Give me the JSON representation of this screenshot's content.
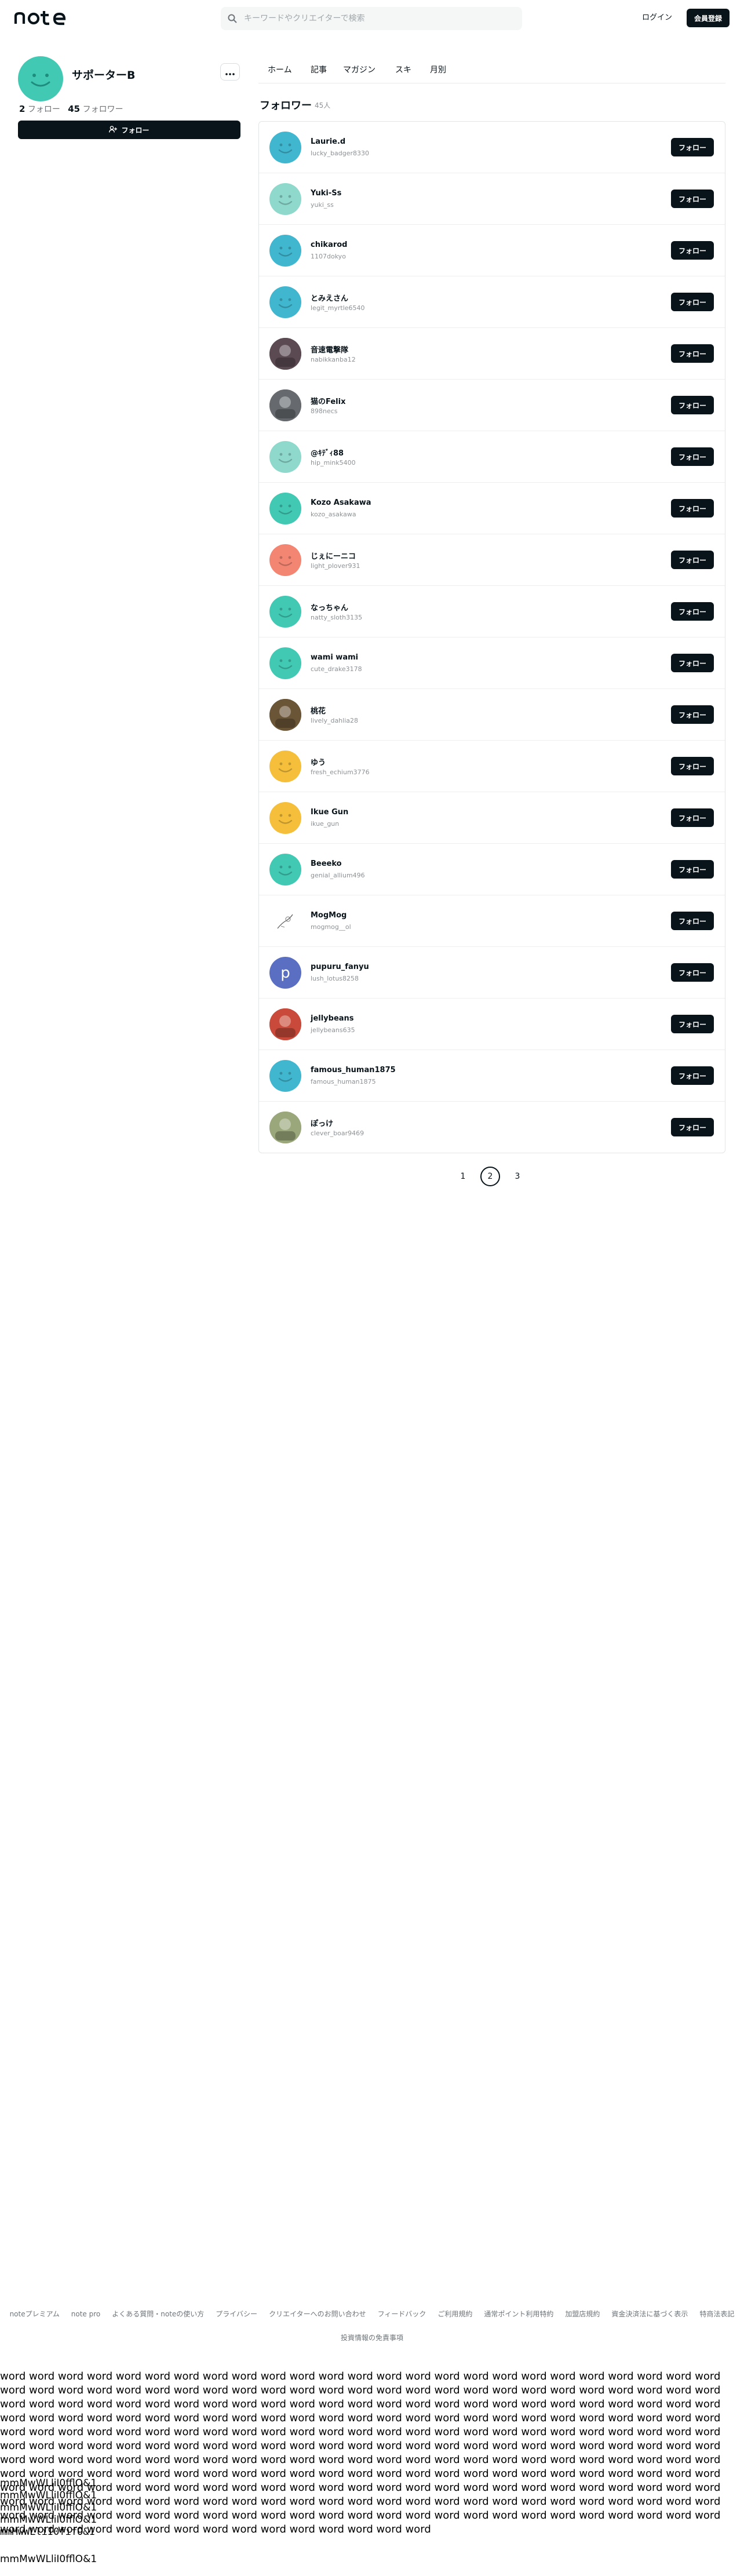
{
  "header": {
    "logo": "note",
    "search_placeholder": "キーワードやクリエイターで検索",
    "login_label": "ログイン",
    "signup_label": "会員登録"
  },
  "profile": {
    "name": "サポーターB",
    "follow_count": "2",
    "follow_label": "フォロー",
    "follower_count": "45",
    "follower_label": "フォロワー",
    "follow_button_label": "フォロー",
    "avatar_color": "#41c9b4"
  },
  "tabs": [
    "ホーム",
    "記事",
    "マガジン",
    "スキ",
    "月別"
  ],
  "section": {
    "title": "フォロワー",
    "count": "45人"
  },
  "followers": [
    {
      "name": "Laurie.d",
      "id": "lucky_badger8330",
      "color": "#41b6cf",
      "kind": "smile",
      "button": "フォロー"
    },
    {
      "name": "Yuki-Ss",
      "id": "yuki_ss",
      "color": "#8ed9cc",
      "kind": "smile",
      "button": "フォロー"
    },
    {
      "name": "chikarod",
      "id": "1107dokyo",
      "color": "#41b6cf",
      "kind": "smile",
      "button": "フォロー"
    },
    {
      "name": "とみえさん",
      "id": "legit_myrtle6540",
      "color": "#41b6cf",
      "kind": "smile",
      "button": "フォロー"
    },
    {
      "name": "音速電撃隊",
      "id": "nabikkanba12",
      "color": "#5b4a52",
      "kind": "photo",
      "button": "フォロー"
    },
    {
      "name": "猫のFelix",
      "id": "898necs",
      "color": "#666a6e",
      "kind": "photo",
      "button": "フォロー"
    },
    {
      "name": "@ｷﾃﾞｨ88",
      "id": "hip_mink5400",
      "color": "#8ed9cc",
      "kind": "smile",
      "button": "フォロー"
    },
    {
      "name": "Kozo Asakawa",
      "id": "kozo_asakawa",
      "color": "#41c9b4",
      "kind": "smile",
      "button": "フォロー"
    },
    {
      "name": "じぇにーニコ",
      "id": "light_plover931",
      "color": "#f28673",
      "kind": "smile",
      "button": "フォロー"
    },
    {
      "name": "なっちゃん",
      "id": "natty_sloth3135",
      "color": "#41c9b4",
      "kind": "smile",
      "button": "フォロー"
    },
    {
      "name": "wami wami",
      "id": "cute_drake3178",
      "color": "#41c9b4",
      "kind": "smile",
      "button": "フォロー"
    },
    {
      "name": "桃花",
      "id": "lively_dahlia28",
      "color": "#6b5537",
      "kind": "photo",
      "button": "フォロー"
    },
    {
      "name": "ゆう",
      "id": "fresh_echium3776",
      "color": "#f5bf3b",
      "kind": "smile",
      "button": "フォロー"
    },
    {
      "name": "Ikue Gun",
      "id": "ikue_gun",
      "color": "#f5bf3b",
      "kind": "smile",
      "button": "フォロー"
    },
    {
      "name": "Beeeko",
      "id": "genial_allium496",
      "color": "#41c9b4",
      "kind": "smile",
      "button": "フォロー"
    },
    {
      "name": "MogMog",
      "id": "mogmog__ol",
      "color": "#ffffff",
      "kind": "sketch",
      "button": "フォロー"
    },
    {
      "name": "pupuru_fanyu",
      "id": "lush_lotus8258",
      "color": "#5a6fc2",
      "kind": "letter",
      "letter": "p",
      "button": "フォロー"
    },
    {
      "name": "jellybeans",
      "id": "jellybeans635",
      "color": "#c94a3a",
      "kind": "photo",
      "button": "フォロー"
    },
    {
      "name": "famous_human1875",
      "id": "famous_human1875",
      "color": "#41b6cf",
      "kind": "smile",
      "button": "フォロー"
    },
    {
      "name": "ぽっけ",
      "id": "clever_boar9469",
      "color": "#9aa77a",
      "kind": "photo",
      "button": "フォロー"
    }
  ],
  "pagination": {
    "pages": [
      "1",
      "2",
      "3"
    ],
    "current": "2"
  },
  "footer": {
    "links": [
      "noteプレミアム",
      "note pro",
      "よくある質問・noteの使い方",
      "プライバシー",
      "クリエイターへのお問い合わせ",
      "フィードバック",
      "ご利用規約",
      "通常ポイント利用特約",
      "加盟店規約",
      "資金決済法に基づく表示",
      "特商法表記"
    ],
    "extra": "投資情報の免責事項"
  },
  "filler": {
    "words": "word word word word word word word word word word word word word word word word word word word word word word word word word word word word word word word word word word word word word word word word word word word word word word word word word word word word word word word word word word word word word word word word word word word word word word word word word word word word word word word word word word word word word word word word word word word word word word word word word word word word word word word word word word word word word word word word word word word word word word word word word word word word word word word word word word word word word word word word word word word word word word word word word word word word word word word word word word word word word word word word word word word word word word word word word word word word word word word word word word word word word word word word word word word word word word word word word word word word word word word word word word word word word word word word word word word word word word word word word word word word word word word word word word word word word word word word word word word word word word word word word word word word word word word word word word word word word word word word word word word word word word word word word word word word word word word word word word word word word word word word word word word word word word word word word word",
    "glyph_lines": [
      "mmMwWLliI0fflO&1",
      "mmMwWLliI0fflO&1",
      "mmMwWLliI0fflO&1",
      "mmMwWLliI0fflO&1",
      "mmMwWLliI0fifO&1",
      "mmMwWLliI0fflO&1"
    ]
  }
}
